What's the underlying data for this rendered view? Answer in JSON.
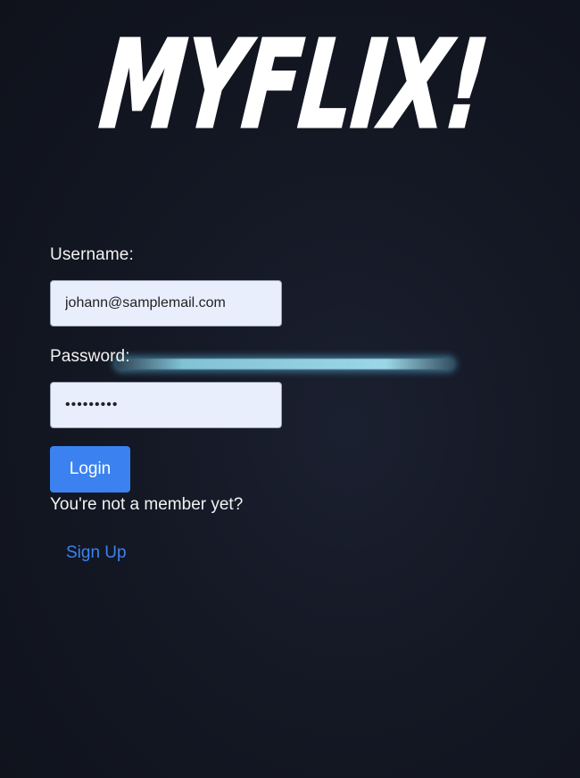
{
  "brand": {
    "logo_text": "MYFLIX!"
  },
  "login_form": {
    "username_label": "Username:",
    "username_value": "johann@samplemail.com",
    "password_label": "Password:",
    "password_value": "•••••••••",
    "login_button_label": "Login",
    "member_prompt": "You're not a member yet?",
    "signup_link_label": "Sign Up"
  },
  "colors": {
    "background": "#141824",
    "input_background": "#e8eefc",
    "accent": "#3b82f0",
    "text": "#f2f2f2"
  }
}
